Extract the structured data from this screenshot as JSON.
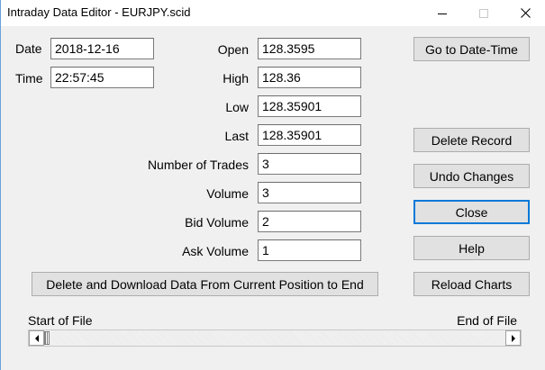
{
  "window": {
    "title": "Intraday Data Editor - EURJPY.scid"
  },
  "labels": {
    "date": "Date",
    "time": "Time",
    "open": "Open",
    "high": "High",
    "low": "Low",
    "last": "Last",
    "num_trades": "Number of Trades",
    "volume": "Volume",
    "bid_volume": "Bid Volume",
    "ask_volume": "Ask Volume",
    "start_of_file": "Start of File",
    "end_of_file": "End of File"
  },
  "fields": {
    "date": "2018-12-16",
    "time": "22:57:45",
    "open": "128.3595",
    "high": "128.36",
    "low": "128.35901",
    "last": "128.35901",
    "num_trades": "3",
    "volume": "3",
    "bid_volume": "2",
    "ask_volume": "1"
  },
  "buttons": {
    "go_to_date_time": "Go to Date-Time",
    "delete_record": "Delete  Record",
    "undo_changes": "Undo Changes",
    "close": "Close",
    "help": "Help",
    "reload_charts": "Reload Charts",
    "delete_and_download": "Delete and Download Data From Current Position to End"
  },
  "icons": {
    "minimize": "minimize-icon",
    "maximize": "maximize-icon",
    "close": "close-icon",
    "scroll_left": "scroll-left-arrow-icon",
    "scroll_right": "scroll-right-arrow-icon"
  },
  "scroll": {
    "position_fraction": 0
  }
}
